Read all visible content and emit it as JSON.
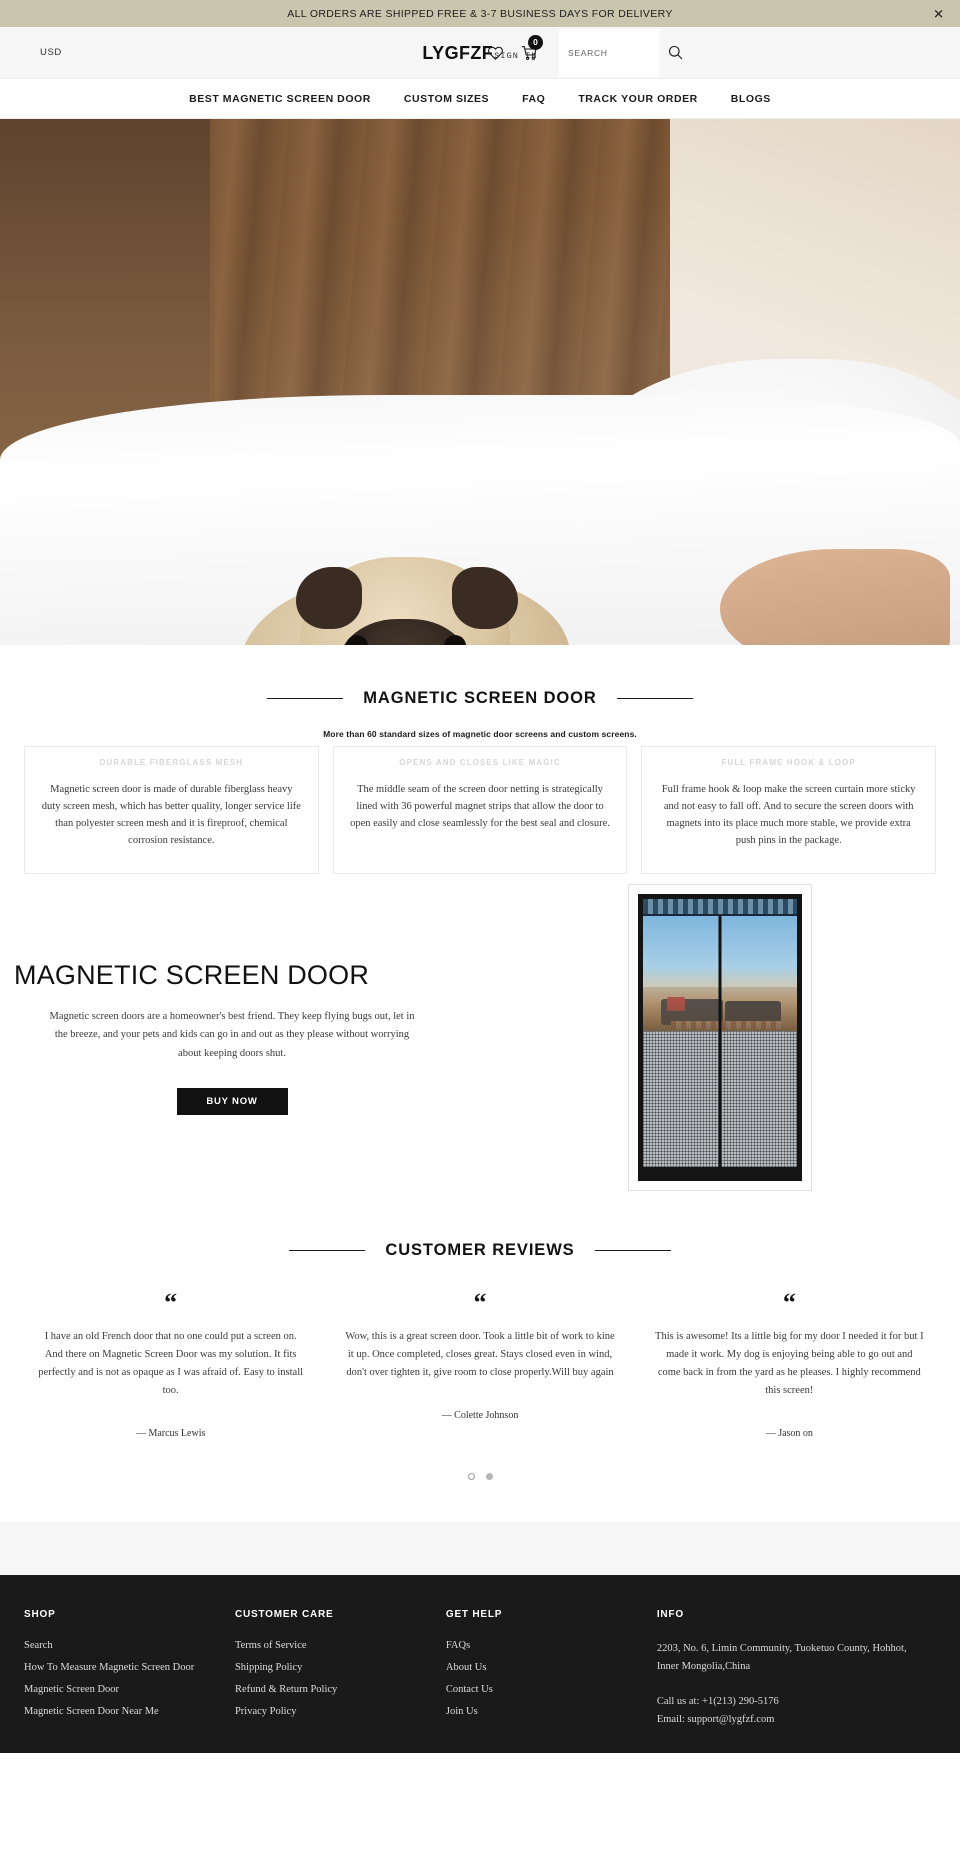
{
  "announcement": {
    "text": "ALL ORDERS ARE SHIPPED FREE & 3-7 BUSINESS DAYS FOR DELIVERY",
    "close_label": "✕"
  },
  "header": {
    "currency": "USD",
    "brand": "LYGFZF",
    "sign_in": "SIGN IN",
    "cart_count": "0",
    "search_placeholder": "SEARCH",
    "search_value": ""
  },
  "nav": {
    "items": [
      {
        "label": "BEST MAGNETIC SCREEN DOOR"
      },
      {
        "label": "CUSTOM SIZES"
      },
      {
        "label": "FAQ"
      },
      {
        "label": "TRACK YOUR ORDER"
      },
      {
        "label": "BLOGS"
      }
    ]
  },
  "features": {
    "title": "MAGNETIC SCREEN DOOR",
    "subtitle": "More than 60 standard sizes of magnetic door screens and custom screens.",
    "cards": [
      {
        "title": "DURABLE FIBERGLASS MESH",
        "text": "Magnetic screen door is made of durable fiberglass heavy duty screen mesh, which has better quality, longer service life than polyester screen mesh and it is fireproof, chemical corrosion resistance."
      },
      {
        "title": "OPENS AND CLOSES LIKE MAGIC",
        "text": "The middle seam of the screen door netting is strategically lined with 36 powerful magnet strips that allow the door to open easily and close seamlessly for the best seal and closure."
      },
      {
        "title": "FULL FRAME HOOK & LOOP",
        "text": "Full frame hook & loop make the screen curtain more sticky and not easy to fall off. And to secure the screen doors with magnets into its place much more stable, we provide extra push pins in the package."
      }
    ]
  },
  "promo": {
    "title": "MAGNETIC SCREEN DOOR",
    "text": "Magnetic screen doors are a homeowner's best friend. They keep flying bugs out, let in the breeze, and your pets and kids can go in and out as they please without worrying about keeping doors shut.",
    "buy_label": "BUY NOW"
  },
  "reviews": {
    "title": "CUSTOMER REVIEWS",
    "quote_glyph": "“",
    "items": [
      {
        "text": "I have an old French door that no one could put a screen on. And there on Magnetic Screen Door was my solution. It fits perfectly and is not as opaque as I was afraid of. Easy to install too.",
        "author": "— Marcus Lewis"
      },
      {
        "text": "Wow, this is a great screen door. Took a little bit of work to kine it up. Once completed, closes great. Stays closed even in wind, don't over tighten it, give room to close properly.Will buy again",
        "author": "— Colette Johnson"
      },
      {
        "text": "This is awesome! Its a little big for my door I needed it for but I made it work. My dog is enjoying being able to go out and come back in from the yard as he pleases. I highly recommend this screen!",
        "author": "— Jason on"
      }
    ],
    "dots": [
      {
        "active": false
      },
      {
        "active": true
      }
    ]
  },
  "footer": {
    "columns": [
      {
        "title": "SHOP",
        "links": [
          "Search",
          "How To Measure Magnetic Screen Door",
          "Magnetic Screen Door",
          "Magnetic Screen Door Near Me"
        ]
      },
      {
        "title": "CUSTOMER CARE",
        "links": [
          "Terms of Service",
          "Shipping Policy",
          "Refund & Return Policy",
          "Privacy Policy"
        ]
      },
      {
        "title": "GET HELP",
        "links": [
          "FAQs",
          "About Us",
          "Contact Us",
          "Join Us"
        ]
      }
    ],
    "info": {
      "title": "INFO",
      "address": "2203, No. 6, Limin Community, Tuoketuo County, Hohhot, Inner Mongolia,China",
      "phone": "Call us at: +1(213) 290-5176",
      "email": "Email: support@lygfzf.com"
    }
  },
  "colors": {
    "announce_bg": "#c9c6ae",
    "header_bg": "#f6f6f6",
    "accent_dark": "#111111",
    "footer_bg": "#1a1a1a",
    "feature_title": "#d6d6d6"
  }
}
